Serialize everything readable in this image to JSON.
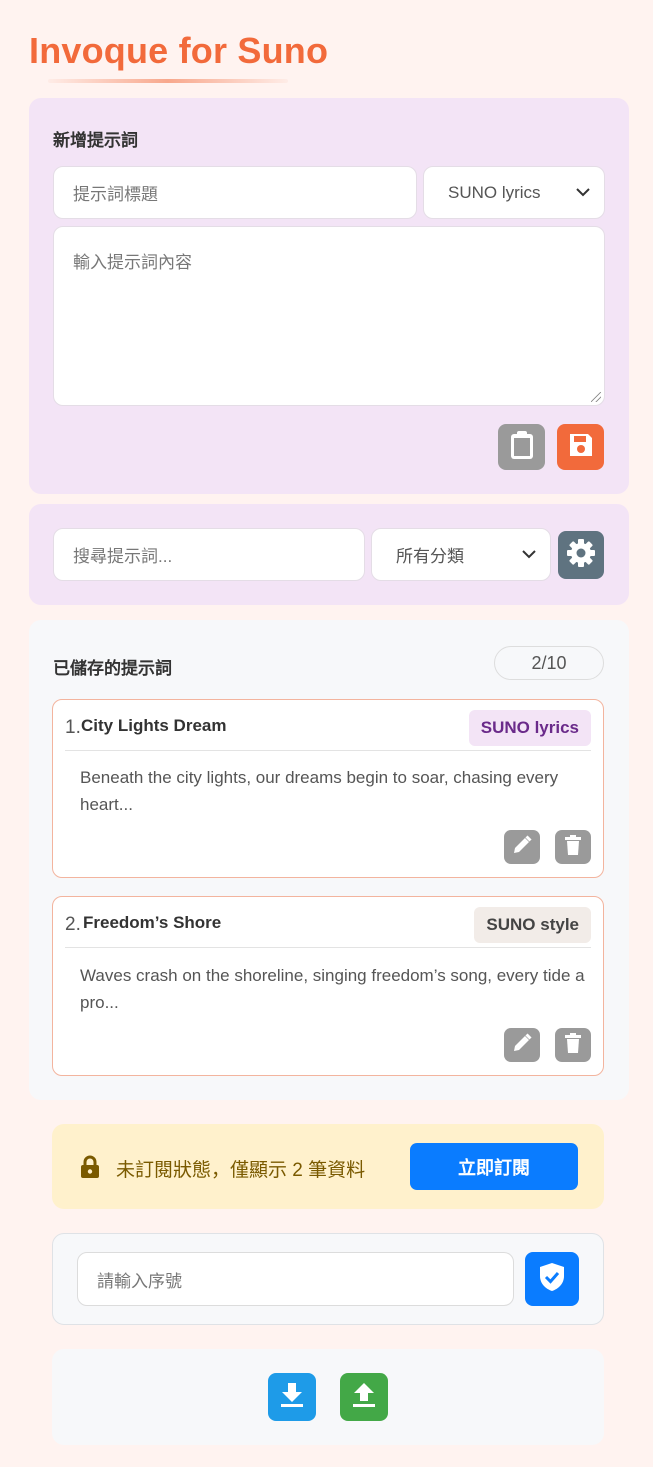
{
  "app": {
    "title": "Invoque for Suno"
  },
  "new_prompt": {
    "heading": "新增提示詞",
    "title_placeholder": "提示詞標題",
    "category_selected": "SUNO lyrics",
    "content_placeholder": "輸入提示詞內容",
    "icons": {
      "paste": "clipboard-icon",
      "save": "floppy-disk-icon"
    }
  },
  "search": {
    "placeholder": "搜尋提示詞...",
    "category_selected": "所有分類",
    "settings_icon": "gear-icon"
  },
  "saved": {
    "heading": "已儲存的提示詞",
    "count": "2/10",
    "items": [
      {
        "num": "1.",
        "title": "City Lights Dream",
        "tag": "SUNO lyrics",
        "body": "Beneath the city lights, our dreams begin to soar, chasing every heart..."
      },
      {
        "num": "2.",
        "title": "Freedom’s Shore",
        "tag": "SUNO style",
        "body": "Waves crash on the shoreline, singing freedom’s song, every tide a pro..."
      }
    ]
  },
  "subscription": {
    "notice": "未訂閱狀態，僅顯示 2 筆資料",
    "button": "立即訂閱",
    "lock_icon": "lock-icon"
  },
  "serial": {
    "placeholder": "請輸入序號",
    "verify_icon": "shield-check-icon"
  },
  "transfer": {
    "download_icon": "download-icon",
    "upload_icon": "upload-icon"
  },
  "colors": {
    "accent": "#f26a3b",
    "purple_panel": "#f3e4f6",
    "blue": "#0a7cff",
    "download": "#1e9be8",
    "upload": "#43a847",
    "notice_bg": "#fff1cc"
  }
}
